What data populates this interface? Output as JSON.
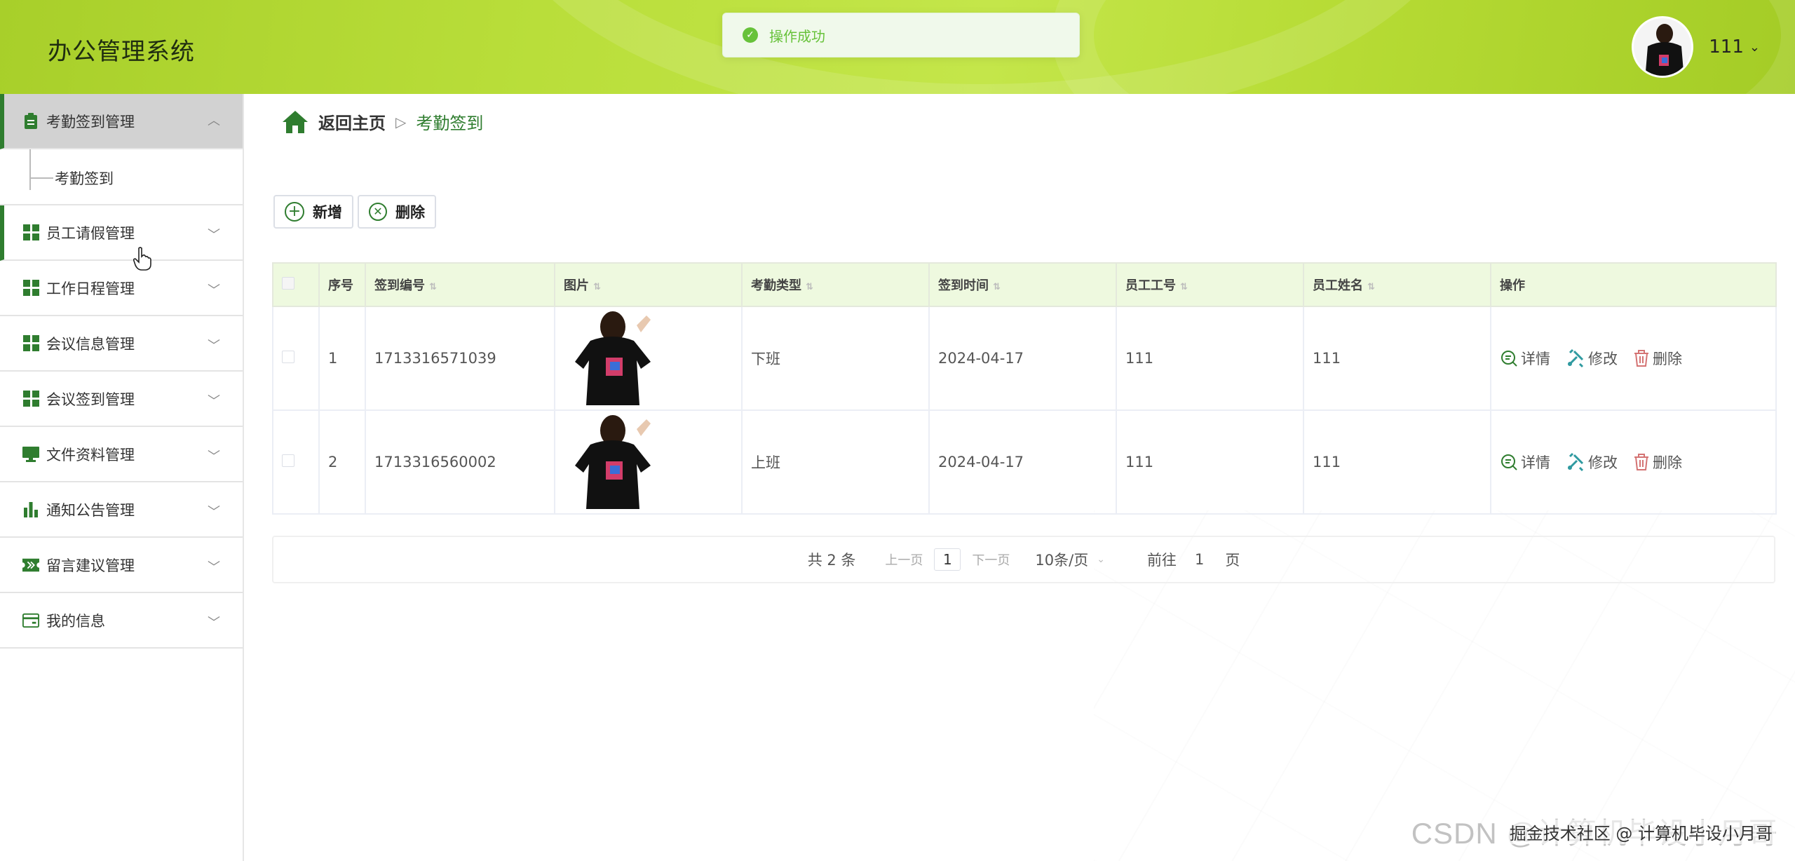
{
  "header": {
    "app_title": "办公管理系统",
    "toast": {
      "text": "操作成功",
      "type": "success"
    },
    "user": {
      "name": "111"
    }
  },
  "sidebar": {
    "items": [
      {
        "label": "考勤签到管理",
        "icon": "clipboard-icon",
        "expanded": true,
        "children": [
          {
            "label": "考勤签到"
          }
        ]
      },
      {
        "label": "员工请假管理",
        "icon": "grid-icon"
      },
      {
        "label": "工作日程管理",
        "icon": "grid-icon"
      },
      {
        "label": "会议信息管理",
        "icon": "grid-icon"
      },
      {
        "label": "会议签到管理",
        "icon": "grid-icon"
      },
      {
        "label": "文件资料管理",
        "icon": "monitor-icon"
      },
      {
        "label": "通知公告管理",
        "icon": "bar-chart-icon"
      },
      {
        "label": "留言建议管理",
        "icon": "ticket-icon"
      },
      {
        "label": "我的信息",
        "icon": "card-icon"
      }
    ]
  },
  "breadcrumb": {
    "home": "返回主页",
    "current": "考勤签到"
  },
  "toolbar": {
    "add_label": "新增",
    "delete_label": "删除"
  },
  "table": {
    "columns": [
      "序号",
      "签到编号",
      "图片",
      "考勤类型",
      "签到时间",
      "员工工号",
      "员工姓名",
      "操作"
    ],
    "rows": [
      {
        "index": "1",
        "code": "1713316571039",
        "type": "下班",
        "time": "2024-04-17",
        "emp_no": "111",
        "emp_name": "111"
      },
      {
        "index": "2",
        "code": "1713316560002",
        "type": "上班",
        "time": "2024-04-17",
        "emp_no": "111",
        "emp_name": "111"
      }
    ],
    "actions": {
      "detail": "详情",
      "edit": "修改",
      "delete": "删除"
    }
  },
  "pagination": {
    "total": "共 2 条",
    "prev": "上一页",
    "current_page": "1",
    "next": "下一页",
    "page_size": "10条/页",
    "goto_prefix": "前往",
    "goto_value": "1",
    "goto_suffix": "页"
  },
  "watermark": {
    "back": "CSDN @计算机毕设小月哥",
    "front": "掘金技术社区 @ 计算机毕设小月哥"
  },
  "colors": {
    "accent": "#2f7d2f",
    "header": "#b9de3a",
    "success": "#67c23a"
  }
}
